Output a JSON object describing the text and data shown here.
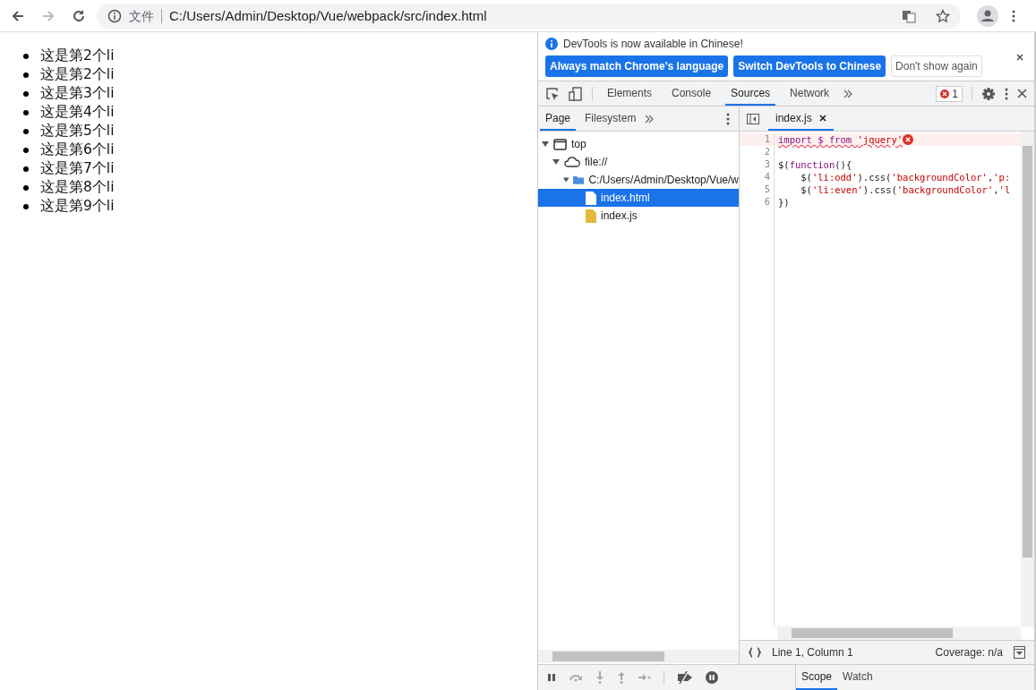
{
  "browser": {
    "security_label": "文件",
    "url": "C:/Users/Admin/Desktop/Vue/webpack/src/index.html"
  },
  "page": {
    "items": [
      "这是第2个li",
      "这是第2个li",
      "这是第3个li",
      "这是第4个li",
      "这是第5个li",
      "这是第6个li",
      "这是第7个li",
      "这是第8个li",
      "这是第9个li"
    ]
  },
  "devtools": {
    "infobar": {
      "message": "DevTools is now available in Chinese!",
      "buttons": [
        {
          "label": "Always match Chrome's language",
          "kind": "primary"
        },
        {
          "label": "Switch DevTools to Chinese",
          "kind": "primary"
        },
        {
          "label": "Don't show again",
          "kind": "secondary"
        }
      ]
    },
    "tabs": [
      {
        "label": "Elements",
        "selected": false
      },
      {
        "label": "Console",
        "selected": false
      },
      {
        "label": "Sources",
        "selected": true
      },
      {
        "label": "Network",
        "selected": false
      }
    ],
    "error_count": "1",
    "navigator_tabs": [
      {
        "label": "Page",
        "selected": true
      },
      {
        "label": "Filesystem",
        "selected": false
      }
    ],
    "tree": [
      {
        "label": "top",
        "kind": "frame",
        "expanded": true,
        "selected": false,
        "children": [
          {
            "label": "file://",
            "kind": "cloud",
            "expanded": true,
            "selected": false,
            "children": [
              {
                "label": "C:/Users/Admin/Desktop/Vue/w",
                "kind": "folder",
                "expanded": true,
                "selected": false,
                "children": [
                  {
                    "label": "index.html",
                    "kind": "html",
                    "selected": true
                  },
                  {
                    "label": "index.js",
                    "kind": "js",
                    "selected": false
                  }
                ]
              }
            ]
          }
        ]
      }
    ],
    "editor_tab": "index.js",
    "code": [
      {
        "number": "1",
        "error": true,
        "tokens": [
          {
            "text": "import $ from ",
            "kind": "keyword"
          },
          {
            "text": "'jquery'",
            "kind": "string"
          }
        ]
      },
      {
        "number": "2",
        "error": false
      },
      {
        "number": "3",
        "error": false,
        "tokens": [
          {
            "text": "$(",
            "kind": "plain"
          },
          {
            "text": "function",
            "kind": "keyword"
          },
          {
            "text": "(){",
            "kind": "plain"
          }
        ]
      },
      {
        "number": "4",
        "error": false,
        "tokens": [
          {
            "text": "    $(",
            "kind": "plain"
          },
          {
            "text": "'li:odd'",
            "kind": "string"
          },
          {
            "text": ").css(",
            "kind": "plain"
          },
          {
            "text": "'backgroundColor'",
            "kind": "string"
          },
          {
            "text": ",",
            "kind": "plain"
          },
          {
            "text": "'p:",
            "kind": "string"
          }
        ]
      },
      {
        "number": "5",
        "error": false,
        "tokens": [
          {
            "text": "    $(",
            "kind": "plain"
          },
          {
            "text": "'li:even'",
            "kind": "string"
          },
          {
            "text": ").css(",
            "kind": "plain"
          },
          {
            "text": "'backgroundColor'",
            "kind": "string"
          },
          {
            "text": ",",
            "kind": "plain"
          },
          {
            "text": "'l",
            "kind": "string"
          }
        ]
      },
      {
        "number": "6",
        "error": false,
        "tokens": [
          {
            "text": "})",
            "kind": "plain"
          }
        ]
      }
    ],
    "status": {
      "position": "Line 1, Column 1",
      "coverage": "Coverage: n/a"
    },
    "sidebar_tabs": [
      {
        "label": "Scope",
        "selected": true
      },
      {
        "label": "Watch",
        "selected": false
      }
    ]
  }
}
